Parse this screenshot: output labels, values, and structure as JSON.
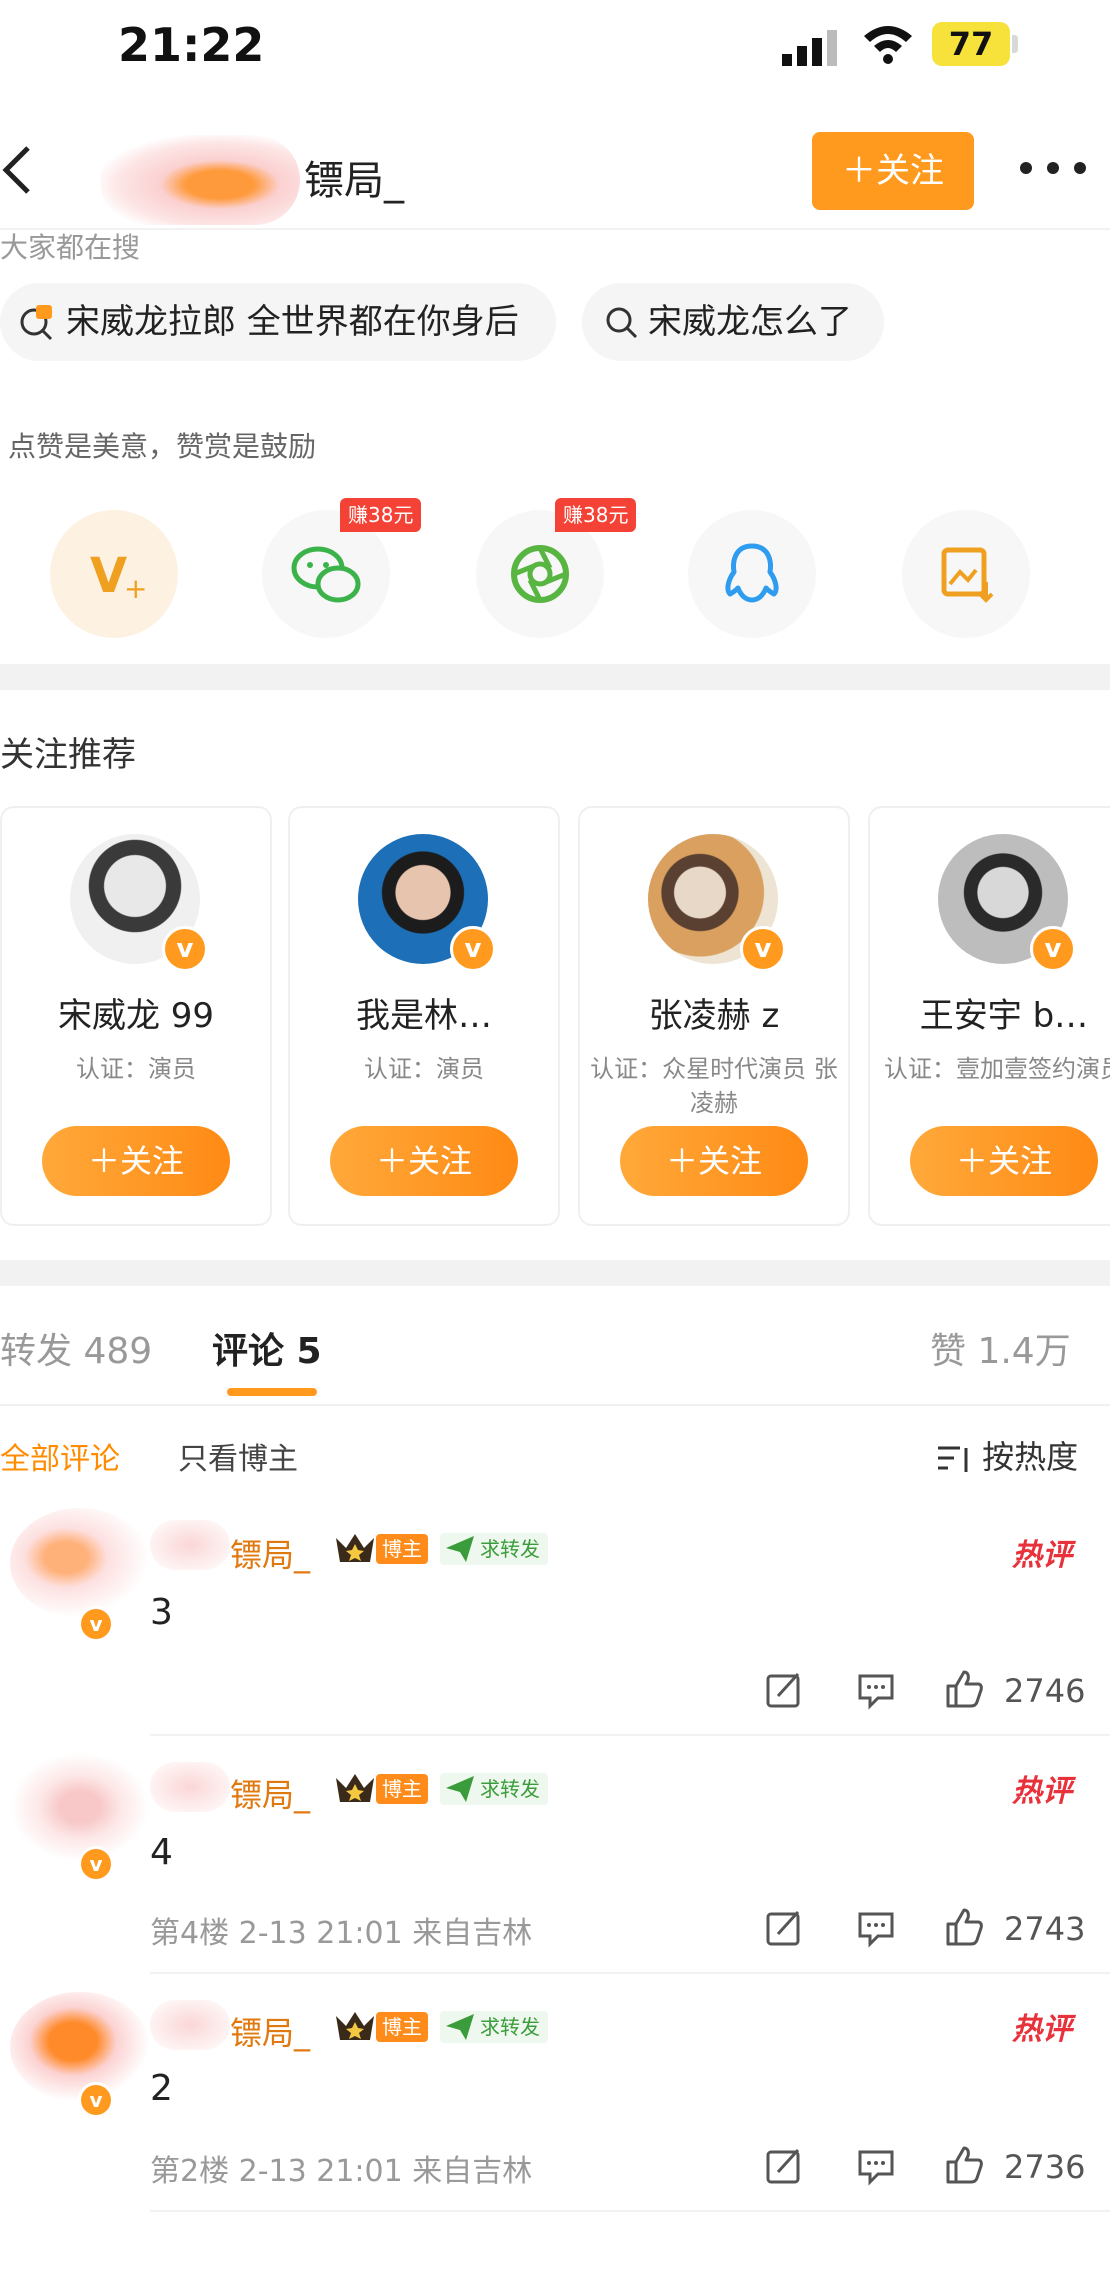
{
  "status": {
    "time": "21:22",
    "battery": "77"
  },
  "nav": {
    "title": "镖局_",
    "follow_label": "＋关注"
  },
  "search": {
    "label": "大家都在搜",
    "chips": [
      "宋威龙拉郎 全世界都在你身后",
      "宋威龙怎么了"
    ]
  },
  "reward": {
    "label": "点赞是美意，赞赏是鼓励",
    "earn_badges": [
      "赚38元",
      "赚38元"
    ],
    "share_icons": [
      "vplus-icon",
      "wechat-icon",
      "moments-icon",
      "qq-icon",
      "save-image-icon"
    ]
  },
  "recommend": {
    "title": "关注推荐",
    "cards": [
      {
        "name": "宋威龙 99",
        "cert": "认证：演员",
        "follow": "＋关注"
      },
      {
        "name": "我是林…",
        "cert": "认证：演员",
        "follow": "＋关注"
      },
      {
        "name": "张凌赫 z",
        "cert": "认证：众星时代演员 张凌赫",
        "follow": "＋关注"
      },
      {
        "name": "王安宇 b…",
        "cert": "认证：壹加壹签约演员",
        "follow": "＋关注"
      }
    ]
  },
  "tabs": {
    "repost": "转发 489",
    "comment": "评论 5",
    "likes": "赞 1.4万"
  },
  "filters": {
    "all": "全部评论",
    "host_only": "只看博主",
    "sort": "按热度"
  },
  "comments": [
    {
      "name": "镖局_",
      "host_badge": "博主",
      "repost_badge": "求转发",
      "hot": "热评",
      "text": "3",
      "meta": "",
      "likes": "2746"
    },
    {
      "name": "镖局_",
      "host_badge": "博主",
      "repost_badge": "求转发",
      "hot": "热评",
      "text": "4",
      "meta": "第4楼 2-13 21:01 来自吉林",
      "likes": "2743"
    },
    {
      "name": "镖局_",
      "host_badge": "博主",
      "repost_badge": "求转发",
      "hot": "热评",
      "text": "2",
      "meta": "第2楼 2-13 21:01 来自吉林",
      "likes": "2736"
    }
  ],
  "colors": {
    "accent": "#ff9a1e",
    "hot": "#e8323b",
    "earn": "#f44336"
  }
}
